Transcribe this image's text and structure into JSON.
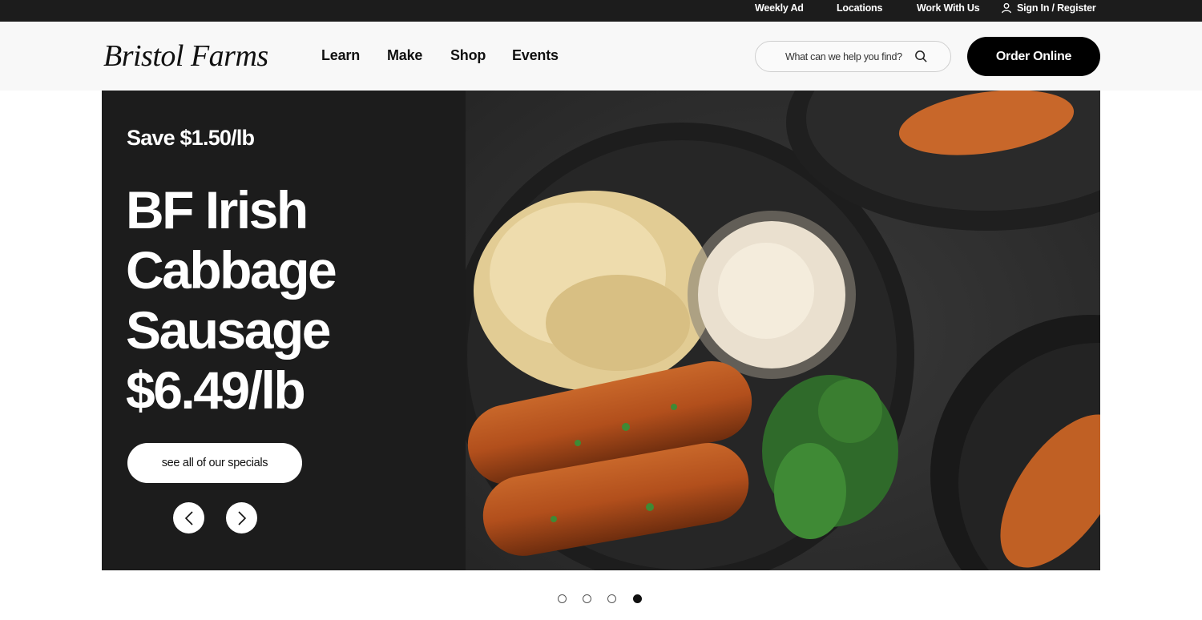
{
  "utility": {
    "weekly_ad": "Weekly Ad",
    "locations": "Locations",
    "work_with_us": "Work With Us",
    "sign_in": "Sign In / Register"
  },
  "header": {
    "logo_text": "Bristol Farms",
    "nav": [
      "Learn",
      "Make",
      "Shop",
      "Events"
    ],
    "search_placeholder": "What can we help you find?",
    "order_button": "Order Online"
  },
  "hero": {
    "kicker": "Save $1.50/lb",
    "headline_lines": [
      "BF Irish",
      "Cabbage",
      "Sausage",
      "$6.49/lb"
    ],
    "cta": "see all of our specials",
    "image_icon": "sausage-sauerkraut-photo",
    "colors": {
      "panel": "#1c1c1c",
      "plate": "#232323",
      "slate": "#2b2b2b"
    }
  },
  "carousel": {
    "slide_count": 4,
    "active_index": 3
  }
}
